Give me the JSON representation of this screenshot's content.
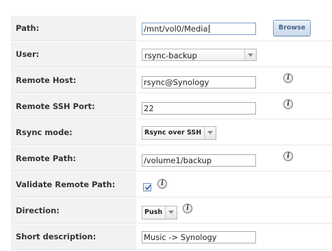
{
  "form": {
    "path": {
      "label": "Path:",
      "value": "/mnt/vol0/Media"
    },
    "browse_label": "Browse",
    "user": {
      "label": "User:",
      "selected": "rsync-backup"
    },
    "remote_host": {
      "label": "Remote Host:",
      "value": "rsync@Synology"
    },
    "remote_ssh_port": {
      "label": "Remote SSH Port:",
      "value": "22"
    },
    "rsync_mode": {
      "label": "Rsync mode:",
      "selected": "Rsync over SSH"
    },
    "remote_path": {
      "label": "Remote Path:",
      "value": "/volume1/backup"
    },
    "validate_remote_path": {
      "label": "Validate Remote Path:",
      "checked": true
    },
    "direction": {
      "label": "Direction:",
      "selected": "Push"
    },
    "short_description": {
      "label": "Short description:",
      "value": "Music -> Synology"
    }
  },
  "icons": {
    "info": "info-icon",
    "dropdown": "chevron-down-icon",
    "check": "checkmark-icon"
  },
  "colors": {
    "label_background": "#f2f2f2",
    "button_text": "#4a6484",
    "button_border": "#7a98bd"
  }
}
